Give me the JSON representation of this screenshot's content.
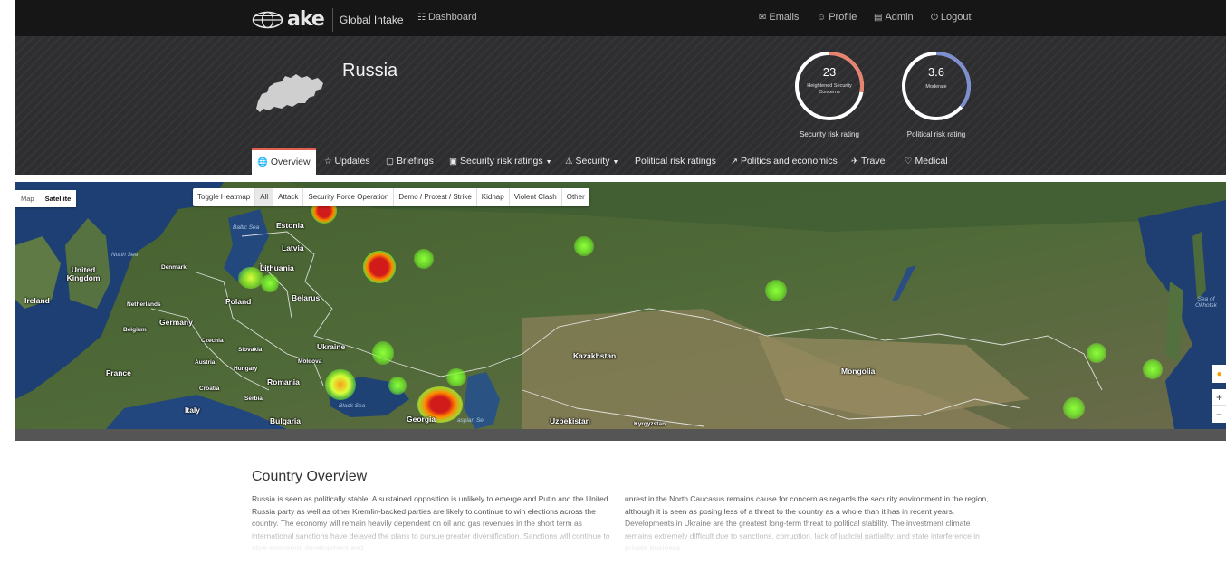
{
  "navbar": {
    "brand_logo_text": "ake",
    "product_name": "Global Intake",
    "links": [
      {
        "label": "Dashboard",
        "icon": "dashboard-icon"
      },
      {
        "label": "Emails",
        "icon": "mail-icon"
      },
      {
        "label": "Profile",
        "icon": "user-icon"
      },
      {
        "label": "Admin",
        "icon": "book-icon"
      },
      {
        "label": "Logout",
        "icon": "power-icon"
      }
    ]
  },
  "hero": {
    "country": "Russia",
    "security_rating": {
      "value": "23",
      "descriptor": "Heightened Security Concerns",
      "caption": "Security risk rating",
      "fill_fraction": 0.28,
      "color": "#e8826e"
    },
    "political_rating": {
      "value": "3.6",
      "descriptor": "Moderate",
      "caption": "Political risk rating",
      "fill_fraction": 0.36,
      "color": "#7c8fd0"
    }
  },
  "tabs": [
    {
      "label": "Overview",
      "icon": "globe-icon",
      "active": true
    },
    {
      "label": "Updates",
      "icon": "star-icon"
    },
    {
      "label": "Briefings",
      "icon": "comment-icon"
    },
    {
      "label": "Security risk ratings",
      "icon": "image-icon",
      "dropdown": true
    },
    {
      "label": "Security",
      "icon": "warning-icon",
      "dropdown": true
    },
    {
      "label": "Political risk ratings",
      "icon": ""
    },
    {
      "label": "Politics and economics",
      "icon": "trend-icon"
    },
    {
      "label": "Travel",
      "icon": "plane-icon"
    },
    {
      "label": "Medical",
      "icon": "heart-icon"
    }
  ],
  "map": {
    "map_types": [
      "Map",
      "Satellite"
    ],
    "selected_map_type": "Satellite",
    "filters": [
      "Toggle Heatmap",
      "All",
      "Attack",
      "Security Force Operation",
      "Demo / Protest / Strike",
      "Kidnap",
      "Violent Clash",
      "Other"
    ],
    "selected_filter": "All",
    "labels": {
      "estonia": "Estonia",
      "latvia": "Latvia",
      "lithuania": "Lithuania",
      "united_kingdom": "United Kingdom",
      "ireland": "Ireland",
      "denmark": "Denmark",
      "netherlands": "Netherlands",
      "belgium": "Belgium",
      "germany": "Germany",
      "poland": "Poland",
      "belarus": "Belarus",
      "czechia": "Czechia",
      "slovakia": "Slovakia",
      "austria": "Austria",
      "hungary": "Hungary",
      "moldova": "Moldova",
      "ukraine": "Ukraine",
      "france": "France",
      "croatia": "Croatia",
      "romania": "Romania",
      "serbia": "Serbia",
      "italy": "Italy",
      "bulgaria": "Bulgaria",
      "georgia": "Georgia",
      "kazakhstan": "Kazakhstan",
      "uzbekistan": "Uzbekistan",
      "kyrgyzstan": "Kyrgyzstan",
      "mongolia": "Mongolia",
      "north_sea": "North Sea",
      "baltic_sea": "Baltic Sea",
      "black_sea": "Black Sea",
      "caspian_sea": "aspian Se",
      "sea_of_okhotsk": "Sea of Okhotsk"
    }
  },
  "overview": {
    "title": "Country Overview",
    "col1": "Russia is seen as politically stable. A sustained opposition is unlikely to emerge and Putin and the United Russia party as well as other Kremlin-backed parties are likely to continue to win elections across the country. The economy will remain heavily dependent on oil and gas revenues in the short term as international sanctions have delayed the plans to pursue greater diversification. Sanctions will continue to slow economic development and",
    "col2": "unrest in the North Caucasus remains cause for concern as regards the security environment in the region, although it is seen as posing less of a threat to the country as a whole than it has in recent years. Developments in Ukraine are the greatest long-term threat to political stability. The investment climate remains extremely difficult due to sanctions, corruption, lack of judicial partiality, and state interference in private business."
  }
}
